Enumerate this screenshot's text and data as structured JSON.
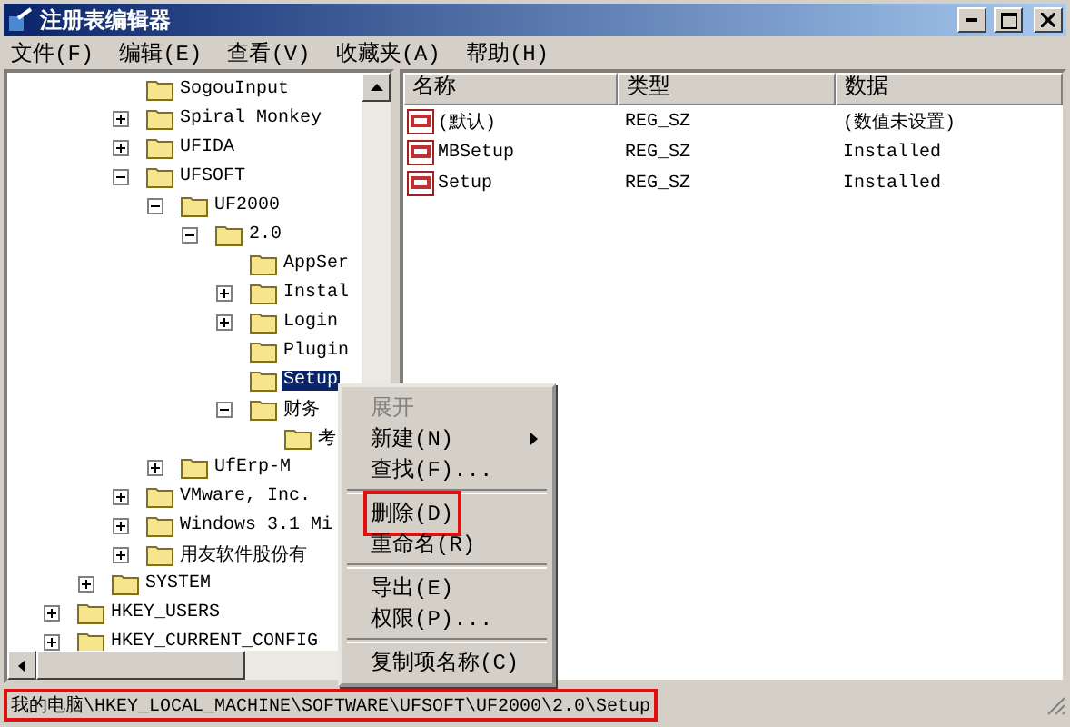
{
  "window": {
    "title": "注册表编辑器"
  },
  "menu": [
    "文件(F)",
    "编辑(E)",
    "查看(V)",
    "收藏夹(A)",
    "帮助(H)"
  ],
  "tree": {
    "items": [
      {
        "children": [
          {
            "children": [
              {
                "label": "SogouInput",
                "selected": false
              },
              {
                "label": "Spiral Monkey",
                "expanded": false,
                "selected": false
              },
              {
                "label": "UFIDA",
                "expanded": false,
                "selected": false
              },
              {
                "label": "UFSOFT",
                "expanded": true,
                "selected": false,
                "children": [
                  {
                    "label": "UF2000",
                    "expanded": true,
                    "selected": false,
                    "children": [
                      {
                        "label": "2.0",
                        "expanded": true,
                        "selected": false,
                        "children": [
                          {
                            "label": "AppSer",
                            "selected": false
                          },
                          {
                            "label": "Instal",
                            "expanded": false,
                            "selected": false
                          },
                          {
                            "label": "Login",
                            "expanded": false,
                            "selected": false
                          },
                          {
                            "label": "Plugin",
                            "selected": false
                          },
                          {
                            "label": "Setup",
                            "selected": true
                          },
                          {
                            "label": "财务",
                            "expanded": true,
                            "selected": false,
                            "children": [
                              {
                                "label": "考",
                                "selected": false
                              }
                            ]
                          }
                        ]
                      }
                    ]
                  },
                  {
                    "label": "UfErp-M",
                    "expanded": false,
                    "selected": false
                  }
                ]
              },
              {
                "label": "VMware, Inc.",
                "expanded": false,
                "selected": false
              },
              {
                "label": "Windows 3.1 Mi",
                "expanded": false,
                "selected": false
              },
              {
                "label": "用友软件股份有",
                "expanded": false,
                "selected": false
              }
            ]
          },
          {
            "label": "SYSTEM",
            "expanded": false,
            "selected": false
          }
        ]
      },
      {
        "label": "HKEY_USERS",
        "expanded": false,
        "selected": false
      },
      {
        "label": "HKEY_CURRENT_CONFIG",
        "expanded": false,
        "selected": false
      }
    ]
  },
  "values": {
    "columns": [
      "名称",
      "类型",
      "数据"
    ],
    "rows": [
      {
        "name": "(默认)",
        "type": "REG_SZ",
        "data": "(数值未设置)"
      },
      {
        "name": "MBSetup",
        "type": "REG_SZ",
        "data": "Installed"
      },
      {
        "name": "Setup",
        "type": "REG_SZ",
        "data": "Installed"
      }
    ]
  },
  "context_menu": [
    {
      "kind": "item",
      "label": "展开",
      "disabled": true
    },
    {
      "kind": "item",
      "label": "新建(N)",
      "submenu": true
    },
    {
      "kind": "item",
      "label": "查找(F)..."
    },
    {
      "kind": "separator"
    },
    {
      "kind": "item",
      "label": "删除(D)",
      "highlighted": true
    },
    {
      "kind": "item",
      "label": "重命名(R)"
    },
    {
      "kind": "separator"
    },
    {
      "kind": "item",
      "label": "导出(E)"
    },
    {
      "kind": "item",
      "label": "权限(P)..."
    },
    {
      "kind": "separator"
    },
    {
      "kind": "item",
      "label": "复制项名称(C)"
    }
  ],
  "status_bar": {
    "text": "我的电脑\\HKEY_LOCAL_MACHINE\\SOFTWARE\\UFSOFT\\UF2000\\2.0\\Setup",
    "highlighted": true
  }
}
